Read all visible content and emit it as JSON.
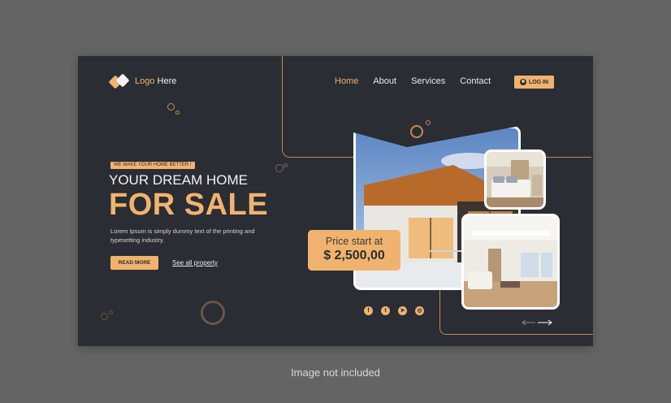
{
  "logo": {
    "text_accent": "Logo",
    "text_rest": " Here"
  },
  "nav": {
    "items": [
      "Home",
      "About",
      "Services",
      "Contact"
    ],
    "active": "Home"
  },
  "login": {
    "label": "LOG IN",
    "icon": "user-icon"
  },
  "hero": {
    "tag": "WE MAKE YOUR HOME BETTER !",
    "headline_1": "YOUR DREAM HOME",
    "headline_2": "FOR SALE",
    "description": "Lorem Ipsum is simply dummy text of the printing and typesetting industry.",
    "read_more": "READ MORE",
    "see_all": "See all property"
  },
  "price": {
    "label": "Price start at",
    "value": "$ 2,500,00"
  },
  "social": {
    "icons": [
      "facebook-icon",
      "twitter-icon",
      "telegram-icon",
      "instagram-icon"
    ],
    "glyphs": [
      "f",
      "t",
      "➤",
      "◎"
    ]
  },
  "caption": "Image not included",
  "colors": {
    "accent": "#f0b36f",
    "background": "#2a2d33",
    "page": "#646464"
  }
}
